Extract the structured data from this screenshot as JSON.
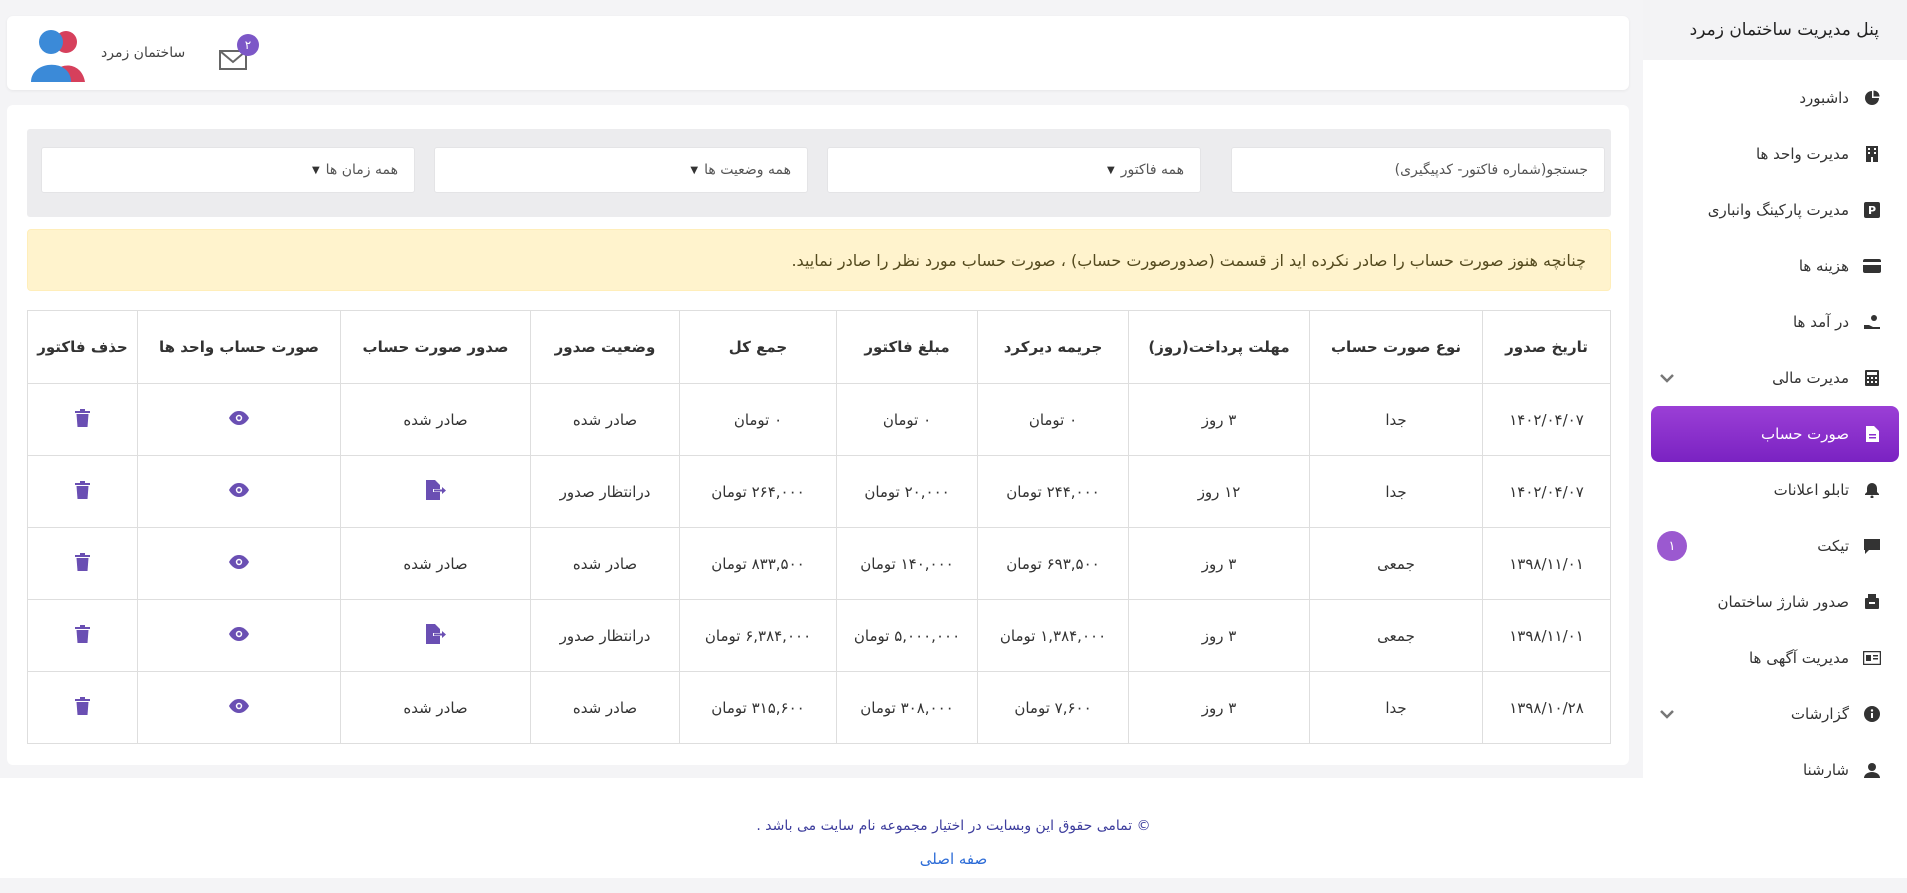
{
  "sidebar": {
    "title": "پنل مدیریت ساختمان زمرد",
    "items": [
      {
        "label": "داشبورد",
        "icon": "pie-chart-icon"
      },
      {
        "label": "مدیرت واحد ها",
        "icon": "building-icon"
      },
      {
        "label": "مدیرت پارکینگ وانباری",
        "icon": "parking-icon"
      },
      {
        "label": "هزینه ها",
        "icon": "credit-card-icon"
      },
      {
        "label": "در آمد ها",
        "icon": "hand-coin-icon"
      },
      {
        "label": "مدیرت مالی",
        "icon": "calculator-icon"
      },
      {
        "label": "صورت حساب",
        "icon": "file-icon"
      },
      {
        "label": "تابلو اعلانات",
        "icon": "bell-icon"
      },
      {
        "label": "تیکت",
        "icon": "chat-icon",
        "badge": "۱"
      },
      {
        "label": "صدور شارژ ساختمان",
        "icon": "box-icon"
      },
      {
        "label": "مدیریت آگهی ها",
        "icon": "ad-icon"
      },
      {
        "label": "گزارشات",
        "icon": "info-icon"
      },
      {
        "label": "شارشنا",
        "icon": "user-icon"
      }
    ]
  },
  "topbar": {
    "user_name": "ساختمان زمرد",
    "mail_badge": "۲"
  },
  "filters": {
    "search_placeholder": "جستجو(شماره فاکتور- کدپیگیری)",
    "invoice_type": "همه فاکتور",
    "status": "همه وضعیت ها",
    "time": "همه زمان ها"
  },
  "alert_text": "چنانچه هنوز صورت حساب را صادر نکرده اید از قسمت (صدورصورت حساب) ، صورت حساب مورد نظر را صادر نمایید.",
  "table": {
    "headers": [
      "تاریخ صدور",
      "نوع صورت حساب",
      "مهلت پرداخت(روز)",
      "جریمه دیرکرد",
      "مبلغ فاکتور",
      "جمع کل",
      "وضعیت صدور",
      "صدور صورت حساب",
      "صورت حساب واحد ها",
      "حذف فاکتور"
    ],
    "rows": [
      {
        "date": "۱۴۰۲/۰۴/۰۷",
        "type": "جدا",
        "deadline": "۳ روز",
        "penalty": "۰ تومان",
        "amount": "۰ تومان",
        "total": "۰ تومان",
        "status": "صادر شده",
        "issue": "صادر شده"
      },
      {
        "date": "۱۴۰۲/۰۴/۰۷",
        "type": "جدا",
        "deadline": "۱۲ روز",
        "penalty": "۲۴۴,۰۰۰ تومان",
        "amount": "۲۰,۰۰۰ تومان",
        "total": "۲۶۴,۰۰۰ تومان",
        "status": "درانتظار صدور",
        "issue": ""
      },
      {
        "date": "۱۳۹۸/۱۱/۰۱",
        "type": "جمعی",
        "deadline": "۳ روز",
        "penalty": "۶۹۳,۵۰۰ تومان",
        "amount": "۱۴۰,۰۰۰ تومان",
        "total": "۸۳۳,۵۰۰ تومان",
        "status": "صادر شده",
        "issue": "صادر شده"
      },
      {
        "date": "۱۳۹۸/۱۱/۰۱",
        "type": "جمعی",
        "deadline": "۳ روز",
        "penalty": "۱,۳۸۴,۰۰۰ تومان",
        "amount": "۵,۰۰۰,۰۰۰ تومان",
        "total": "۶,۳۸۴,۰۰۰ تومان",
        "status": "درانتظار صدور",
        "issue": ""
      },
      {
        "date": "۱۳۹۸/۱۰/۲۸",
        "type": "جدا",
        "deadline": "۳ روز",
        "penalty": "۷,۶۰۰ تومان",
        "amount": "۳۰۸,۰۰۰ تومان",
        "total": "۳۱۵,۶۰۰ تومان",
        "status": "صادر شده",
        "issue": "صادر شده"
      }
    ]
  },
  "footer": {
    "copyright": "© تمامی حقوق این وبسایت در اختیار مجموعه نام سایت می باشد .",
    "home_link": "صفه اصلی"
  },
  "colors": {
    "accent": "#7c57c7",
    "active_menu": "#8a2fcf",
    "alert_bg": "#fff3cd",
    "link": "#2d6cd7"
  }
}
